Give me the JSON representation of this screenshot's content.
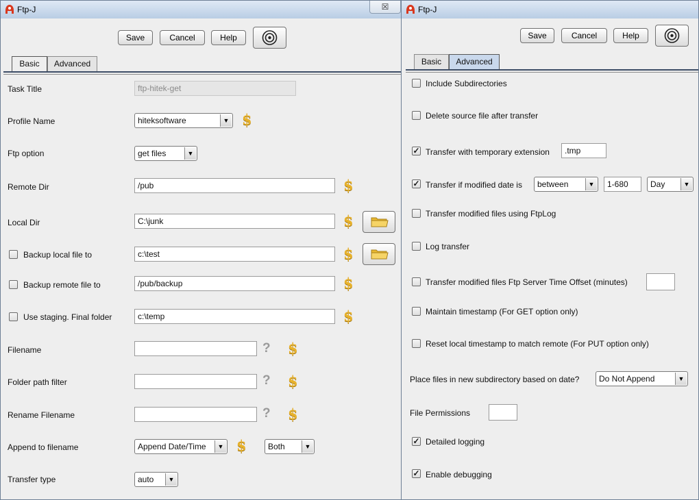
{
  "left_window": {
    "title": "Ftp-J",
    "close_label": "☒",
    "buttons": {
      "save": "Save",
      "cancel": "Cancel",
      "help": "Help"
    },
    "tabs": [
      "Basic",
      "Advanced"
    ],
    "active_tab": "Basic",
    "fields": {
      "task_title": {
        "label": "Task Title",
        "value": "ftp-hitek-get"
      },
      "profile_name": {
        "label": "Profile Name",
        "value": "hiteksoftware"
      },
      "ftp_option": {
        "label": "Ftp option",
        "value": "get files"
      },
      "remote_dir": {
        "label": "Remote Dir",
        "value": "/pub"
      },
      "local_dir": {
        "label": "Local Dir",
        "value": "C:\\junk"
      },
      "backup_local": {
        "label": "Backup local file to",
        "value": "c:\\test",
        "checked": false
      },
      "backup_remote": {
        "label": "Backup remote file to",
        "value": "/pub/backup",
        "checked": false
      },
      "staging": {
        "label": "Use staging.  Final folder",
        "value": "c:\\temp",
        "checked": false
      },
      "filename": {
        "label": "Filename",
        "value": ""
      },
      "folder_path_filter": {
        "label": "Folder path filter",
        "value": ""
      },
      "rename_filename": {
        "label": "Rename Filename",
        "value": ""
      },
      "append": {
        "label": "Append to filename",
        "value": "Append Date/Time",
        "extra": "Both"
      },
      "transfer_type": {
        "label": "Transfer type",
        "value": "auto"
      }
    },
    "dollar": "$",
    "qmark": "?"
  },
  "right_window": {
    "title": "Ftp-J",
    "buttons": {
      "save": "Save",
      "cancel": "Cancel",
      "help": "Help"
    },
    "tabs": [
      "Basic",
      "Advanced"
    ],
    "active_tab": "Advanced",
    "options": {
      "include_subdirs": {
        "label": "Include Subdirectories",
        "checked": false
      },
      "delete_source": {
        "label": "Delete source file after transfer",
        "checked": false
      },
      "temp_ext": {
        "label": "Transfer with temporary extension",
        "checked": true,
        "value": ".tmp"
      },
      "modified_date": {
        "label": "Transfer if modified date is",
        "checked": true,
        "op": "between",
        "range": "1-680",
        "unit": "Day"
      },
      "ftplog": {
        "label": "Transfer modified files using FtpLog",
        "checked": false
      },
      "log_transfer": {
        "label": "Log transfer",
        "checked": false
      },
      "server_offset": {
        "label": "Transfer modified files  Ftp Server Time Offset (minutes)",
        "checked": false,
        "value": ""
      },
      "maintain_ts": {
        "label": "Maintain timestamp (For GET option only)",
        "checked": false
      },
      "reset_ts": {
        "label": "Reset local timestamp to match remote (For PUT option only)",
        "checked": false
      },
      "subdir_date": {
        "label": "Place files in new subdirectory based on date?",
        "value": "Do Not Append"
      },
      "file_permissions": {
        "label": "File Permissions",
        "value": ""
      },
      "detailed_logging": {
        "label": "Detailed logging",
        "checked": true
      },
      "debugging": {
        "label": "Enable debugging",
        "checked": true
      }
    },
    "check_mark": "✓"
  },
  "colors": {
    "dollar": "#e8b22c",
    "tab_active_adv": "#c9d8ec",
    "title_bar": "#b9cde4"
  },
  "icons": [
    "app-icon",
    "close-icon",
    "screen-icon",
    "folder-icon",
    "dollar-icon",
    "question-icon",
    "dropdown-arrow-icon",
    "checkbox-icon"
  ]
}
